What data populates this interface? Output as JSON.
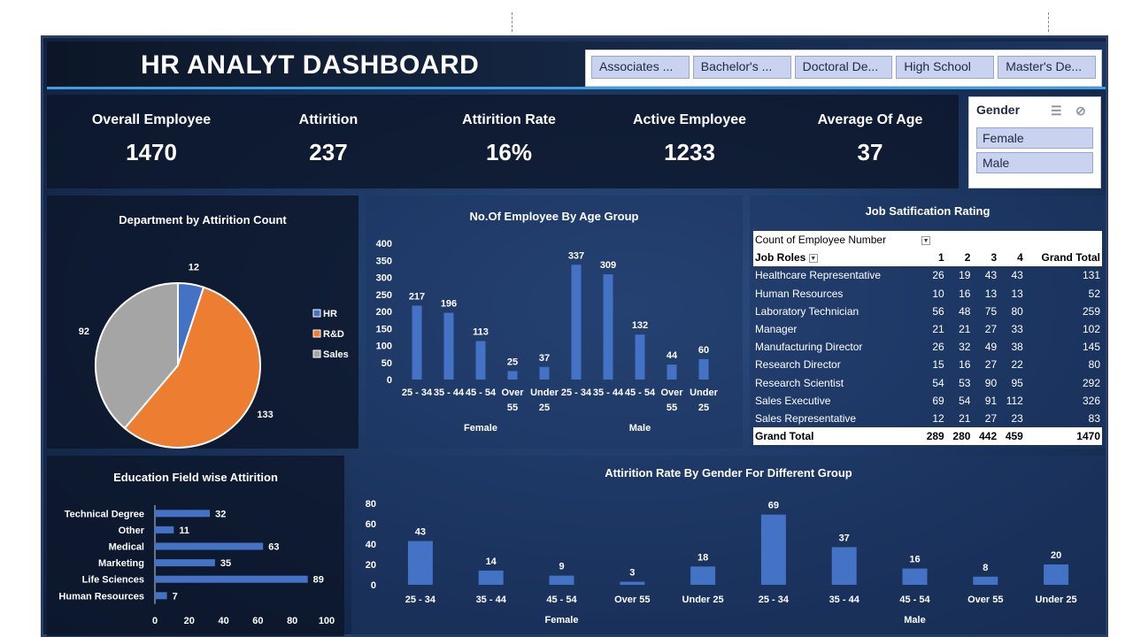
{
  "header": {
    "title": "HR ANALYT DASHBOARD"
  },
  "education_slicer": {
    "items": [
      "Associates ...",
      "Bachelor's ...",
      "Doctoral De...",
      "High School",
      "Master's De..."
    ]
  },
  "kpis": [
    {
      "label": "Overall Employee",
      "value": "1470"
    },
    {
      "label": "Attirition",
      "value": "237"
    },
    {
      "label": "Attirition Rate",
      "value": "16%"
    },
    {
      "label": "Active Employee",
      "value": "1233"
    },
    {
      "label": "Average Of Age",
      "value": "37"
    }
  ],
  "gender_slicer": {
    "title": "Gender",
    "items": [
      "Female",
      "Male"
    ]
  },
  "colors": {
    "bar": "#4472c4",
    "hr": "#4472c4",
    "rnd": "#ed7d31",
    "sales": "#a5a5a5",
    "accent": "#3aa0e0"
  },
  "chart_data": [
    {
      "type": "pie",
      "title": "Department by Attirition Count",
      "categories": [
        "HR",
        "R&D",
        "Sales"
      ],
      "values": [
        12,
        133,
        92
      ],
      "legend": "right"
    },
    {
      "type": "bar",
      "title": "No.Of Employee By Age Group",
      "groups": [
        "Female",
        "Male"
      ],
      "categories": [
        "25 - 34",
        "35 - 44",
        "45 - 54",
        "Over 55",
        "Under 25",
        "25 - 34",
        "35 - 44",
        "45 - 54",
        "Over 55",
        "Under 25"
      ],
      "values": [
        217,
        196,
        113,
        25,
        37,
        337,
        309,
        132,
        44,
        60
      ],
      "ylim": [
        0,
        400
      ],
      "yticks": [
        0,
        50,
        100,
        150,
        200,
        250,
        300,
        350,
        400
      ]
    },
    {
      "type": "table",
      "title": "Job Satification Rating",
      "corner_label": "Count of Employee Number",
      "row_label": "Job Roles",
      "columns": [
        "1",
        "2",
        "3",
        "4",
        "Grand Total"
      ],
      "rows": [
        {
          "name": "Healthcare Representative",
          "values": [
            26,
            19,
            43,
            43,
            131
          ]
        },
        {
          "name": "Human Resources",
          "values": [
            10,
            16,
            13,
            13,
            52
          ]
        },
        {
          "name": "Laboratory Technician",
          "values": [
            56,
            48,
            75,
            80,
            259
          ]
        },
        {
          "name": "Manager",
          "values": [
            21,
            21,
            27,
            33,
            102
          ]
        },
        {
          "name": "Manufacturing Director",
          "values": [
            26,
            32,
            49,
            38,
            145
          ]
        },
        {
          "name": "Research Director",
          "values": [
            15,
            16,
            27,
            22,
            80
          ]
        },
        {
          "name": "Research Scientist",
          "values": [
            54,
            53,
            90,
            95,
            292
          ]
        },
        {
          "name": "Sales Executive",
          "values": [
            69,
            54,
            91,
            112,
            326
          ]
        },
        {
          "name": "Sales Representative",
          "values": [
            12,
            21,
            27,
            23,
            83
          ]
        }
      ],
      "total": {
        "name": "Grand Total",
        "values": [
          289,
          280,
          442,
          459,
          1470
        ]
      }
    },
    {
      "type": "bar",
      "orientation": "horizontal",
      "title": "Education Field wise Attirition",
      "categories": [
        "Technical Degree",
        "Other",
        "Medical",
        "Marketing",
        "Life Sciences",
        "Human Resources"
      ],
      "values": [
        32,
        11,
        63,
        35,
        89,
        7
      ],
      "xlim": [
        0,
        100
      ],
      "xticks": [
        0,
        20,
        40,
        60,
        80,
        100
      ]
    },
    {
      "type": "bar",
      "title": "Attirition Rate By Gender For Different Group",
      "groups": [
        "Female",
        "Male"
      ],
      "categories": [
        "25 - 34",
        "35 - 44",
        "45 - 54",
        "Over 55",
        "Under 25",
        "25 - 34",
        "35 - 44",
        "45 - 54",
        "Over 55",
        "Under 25"
      ],
      "values": [
        43,
        14,
        9,
        3,
        18,
        69,
        37,
        16,
        8,
        20
      ],
      "ylim": [
        0,
        80
      ],
      "yticks": [
        0,
        20,
        40,
        60,
        80
      ]
    }
  ]
}
